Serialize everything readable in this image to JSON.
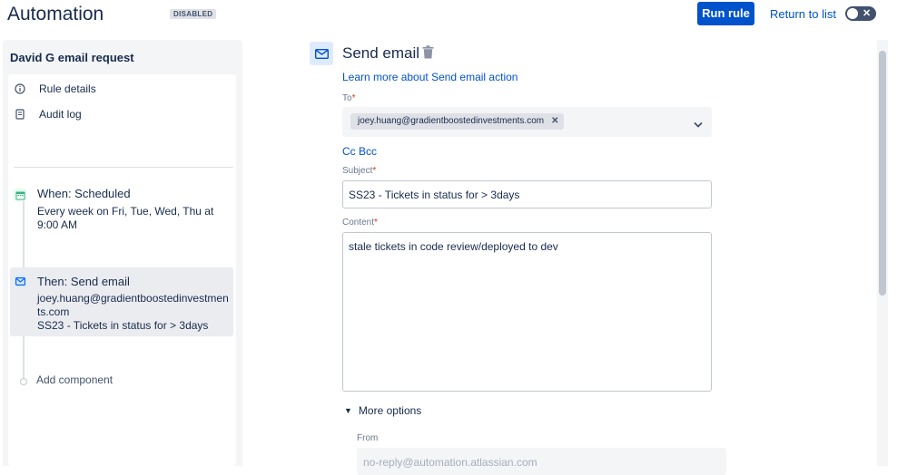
{
  "header": {
    "title": "Automation",
    "status_badge": "DISABLED",
    "run_button": "Run rule",
    "return_link": "Return to list"
  },
  "sidebar": {
    "rule_name": "David G email request",
    "links": [
      {
        "label": "Rule details",
        "icon": "info-icon"
      },
      {
        "label": "Audit log",
        "icon": "document-icon"
      }
    ],
    "trigger": {
      "title": "When: Scheduled",
      "description": "Every week on Fri, Tue, Wed, Thu at 9:00 AM",
      "icon": "calendar-icon",
      "icon_color": "#36b37e"
    },
    "action": {
      "title": "Then: Send email",
      "line1": "joey.huang@gradientboostedinvestments.com",
      "line2": "SS23 - Tickets in status for > 3days",
      "icon": "mail-icon",
      "icon_color": "#0065ff"
    },
    "add_component": "Add component"
  },
  "panel": {
    "title": "Send email",
    "learn_more": "Learn more about Send email action",
    "to_label": "To",
    "to_chip": "joey.huang@gradientboostedinvestments.com",
    "cc": "Cc",
    "bcc": "Bcc",
    "subject_label": "Subject",
    "subject_value": "SS23 - Tickets in status for > 3days",
    "content_label": "Content",
    "content_value": "stale tickets in code review/deployed to dev",
    "more_options": "More options",
    "from_label": "From",
    "from_placeholder": "no-reply@automation.atlassian.com",
    "required_mark": "*"
  },
  "colors": {
    "accent": "#0052cc",
    "required": "#de350b"
  }
}
